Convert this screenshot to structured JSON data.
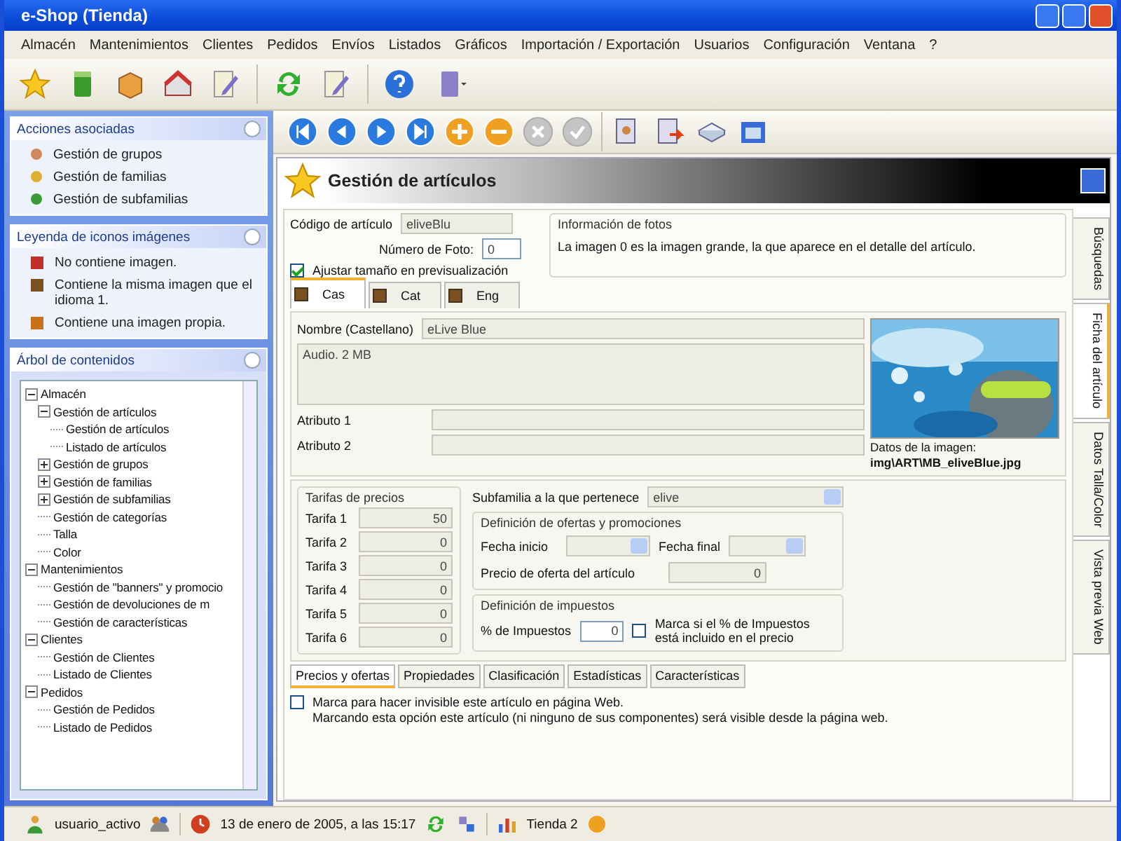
{
  "window": {
    "title": "e-Shop (Tienda)"
  },
  "menu": [
    "Almacén",
    "Mantenimientos",
    "Clientes",
    "Pedidos",
    "Envíos",
    "Listados",
    "Gráficos",
    "Importación / Exportación",
    "Usuarios",
    "Configuración",
    "Ventana",
    "?"
  ],
  "sidebar": {
    "panels": [
      {
        "kind": "actions",
        "title": "Acciones asociadas",
        "items": [
          {
            "label": "Gestión de grupos",
            "color": "#d08a60"
          },
          {
            "label": "Gestión de familias",
            "color": "#e0b030"
          },
          {
            "label": "Gestión de subfamilias",
            "color": "#3a9a3a"
          }
        ]
      },
      {
        "kind": "legend",
        "title": "Leyenda de iconos imágenes",
        "items": [
          {
            "label": "No contiene imagen.",
            "color": "#c0302a"
          },
          {
            "label": "Contiene la misma imagen que el idioma 1.",
            "color": "#7a5020"
          },
          {
            "label": "Contiene una imagen propia.",
            "color": "#c8701a"
          }
        ]
      },
      {
        "kind": "tree",
        "title": "Árbol de contenidos",
        "tree": [
          {
            "label": "Almacén",
            "expanded": true,
            "children": [
              {
                "label": "Gestión de artículos",
                "expanded": true,
                "children": [
                  {
                    "label": "Gestión de artículos"
                  },
                  {
                    "label": "Listado de artículos"
                  }
                ]
              },
              {
                "label": "Gestión de grupos",
                "expanded": false
              },
              {
                "label": "Gestión de familias",
                "expanded": false
              },
              {
                "label": "Gestión de subfamilias",
                "expanded": false
              },
              {
                "label": "Gestión de categorías"
              },
              {
                "label": "Talla"
              },
              {
                "label": "Color"
              }
            ]
          },
          {
            "label": "Mantenimientos",
            "expanded": true,
            "children": [
              {
                "label": "Gestión de \"banners\" y promocio"
              },
              {
                "label": "Gestión de devoluciones de m"
              },
              {
                "label": "Gestión de características"
              }
            ]
          },
          {
            "label": "Clientes",
            "expanded": true,
            "children": [
              {
                "label": "Gestión de Clientes"
              },
              {
                "label": "Listado de Clientes"
              }
            ]
          },
          {
            "label": "Pedidos",
            "expanded": true,
            "children": [
              {
                "label": "Gestión de Pedidos"
              },
              {
                "label": "Listado de Pedidos"
              }
            ]
          }
        ]
      }
    ]
  },
  "nav_toolbar": [
    {
      "kind": "first",
      "disabled": false
    },
    {
      "kind": "previous",
      "disabled": false
    },
    {
      "kind": "next",
      "disabled": false
    },
    {
      "kind": "last",
      "disabled": false
    },
    {
      "kind": "add",
      "disabled": false
    },
    {
      "kind": "remove",
      "disabled": false
    },
    {
      "kind": "cancel",
      "disabled": true
    },
    {
      "kind": "accept",
      "disabled": true
    }
  ],
  "content": {
    "title": "Gestión de artículos",
    "side_tabs": [
      {
        "label": "Búsquedas",
        "selected": false
      },
      {
        "label": "Ficha del artículo",
        "selected": true
      },
      {
        "label": "Datos Talla/Color",
        "selected": false
      },
      {
        "label": "Vista previa Web",
        "selected": false
      }
    ],
    "code": {
      "label": "Código de artículo",
      "value": "eliveBlu"
    },
    "photo_number": {
      "label": "Número de Foto:",
      "value": "0"
    },
    "fit_checkbox": {
      "label": "Ajustar tamaño en previsualización",
      "checked": true
    },
    "photo_info": {
      "title": "Información de fotos",
      "text": "La imagen 0 es la imagen grande, la que aparece en el detalle del artículo."
    },
    "language_tabs": [
      {
        "label": "Cas",
        "selected": true
      },
      {
        "label": "Cat",
        "selected": false
      },
      {
        "label": "Eng",
        "selected": false
      }
    ],
    "name": {
      "label": "Nombre (Castellano)",
      "value": "eLive Blue"
    },
    "description": {
      "value": "Audio. 2 MB"
    },
    "attributes": [
      {
        "label": "Atributo 1"
      },
      {
        "label": "Atributo 2"
      }
    ],
    "image_data": {
      "label": "Datos de la imagen:",
      "path": "img\\ART\\MB_eliveBlue.jpg"
    },
    "prices": {
      "title": "Tarifas de precios",
      "rows": [
        {
          "label": "Tarifa 1",
          "value": "50"
        },
        {
          "label": "Tarifa 2",
          "value": "0"
        },
        {
          "label": "Tarifa 3",
          "value": "0"
        },
        {
          "label": "Tarifa 4",
          "value": "0"
        },
        {
          "label": "Tarifa 5",
          "value": "0"
        },
        {
          "label": "Tarifa 6",
          "value": "0"
        }
      ]
    },
    "subfamily": {
      "label": "Subfamilia a la que pertenece",
      "value": "elive"
    },
    "offers": {
      "title": "Definición de ofertas y promociones",
      "start_label": "Fecha inicio",
      "end_label": "Fecha final",
      "price_label": "Precio de oferta del artículo",
      "price_value": "0"
    },
    "taxes": {
      "title": "Definición de impuestos",
      "label": "% de Impuestos",
      "value": "0",
      "included_label": "Marca si el % de Impuestos está incluido en el precio",
      "included_checked": false
    },
    "bottom_tabs": [
      {
        "label": "Precios y ofertas",
        "selected": true
      },
      {
        "label": "Propiedades",
        "selected": false
      },
      {
        "label": "Clasificación",
        "selected": false
      },
      {
        "label": "Estadísticas",
        "selected": false
      },
      {
        "label": "Características",
        "selected": false
      }
    ],
    "hide_web": {
      "label": "Marca para hacer invisible este artículo en página Web.",
      "note": "Marcando esta opción este artículo (ni ninguno de sus componentes) será visible desde la página web.",
      "checked": false
    }
  },
  "status_bar": {
    "user": "usuario_activo",
    "date": "13 de enero de 2005, a las 15:17",
    "store": "Tienda 2"
  }
}
